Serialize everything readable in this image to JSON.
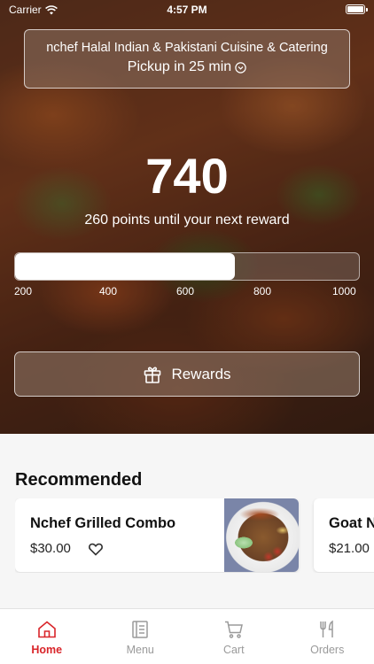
{
  "status_bar": {
    "carrier": "Carrier",
    "time": "4:57 PM"
  },
  "store": {
    "name": "nchef Halal Indian & Pakistani Cuisine & Catering",
    "pickup": "Pickup in 25 min"
  },
  "loyalty": {
    "points": "740",
    "subtitle": "260 points until your next reward",
    "progress_fraction": 0.64,
    "ticks": [
      "200",
      "400",
      "600",
      "800",
      "1000"
    ]
  },
  "rewards_button": {
    "label": "Rewards"
  },
  "recommended": {
    "title": "Recommended",
    "items": [
      {
        "name": "Nchef Grilled Combo",
        "price": "$30.00"
      },
      {
        "name": "Goat N",
        "price": "$21.00"
      }
    ]
  },
  "tabs": [
    {
      "label": "Home",
      "icon": "home-icon",
      "active": true
    },
    {
      "label": "Menu",
      "icon": "menu-icon",
      "active": false
    },
    {
      "label": "Cart",
      "icon": "cart-icon",
      "active": false
    },
    {
      "label": "Orders",
      "icon": "fork-knife-icon",
      "active": false
    }
  ],
  "colors": {
    "accent": "#d9252a",
    "inactive_tab": "#9a9a9a"
  }
}
